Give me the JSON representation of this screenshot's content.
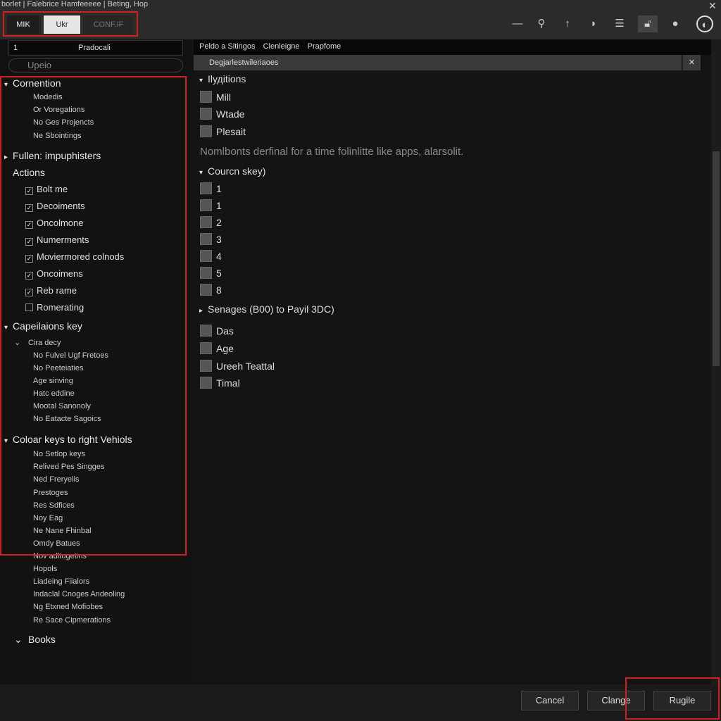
{
  "title": "borlet | Falebrice Hamfeeeee | Beting, Hop",
  "toolbar": {
    "segments": [
      "MIK",
      "Ukr",
      "CONF.IF"
    ],
    "icons": [
      "minimize-icon",
      "search-icon",
      "pin-icon",
      "shield-icon",
      "menu-icon",
      "lock-icon",
      "chat-icon",
      "globe-icon"
    ]
  },
  "left": {
    "field_number": "1",
    "field_value": "Pradocali",
    "search_placeholder": "Upeio",
    "rows": [
      {
        "t": "h1",
        "arrow": "▾",
        "text": "Cornention"
      },
      {
        "t": "h2",
        "text": "Modedis"
      },
      {
        "t": "h2",
        "text": "Or Voregations"
      },
      {
        "t": "h2",
        "text": "No Ges Projencts"
      },
      {
        "t": "h2",
        "text": "Ne Sbointings"
      },
      {
        "t": "h1",
        "arrow": "▸",
        "text": "Fullen: impuphisters"
      },
      {
        "t": "h1",
        "arrow": "",
        "text": "Actions"
      },
      {
        "t": "chk",
        "text": "Bolt me",
        "checked": true
      },
      {
        "t": "chk",
        "text": "Decoiments",
        "checked": true
      },
      {
        "t": "chk",
        "text": "Oncolmone",
        "checked": true
      },
      {
        "t": "chk",
        "text": "Numerments",
        "checked": true
      },
      {
        "t": "chk",
        "text": "Moviermored colnods",
        "checked": true
      },
      {
        "t": "chk",
        "text": "Oncoimens",
        "checked": true
      },
      {
        "t": "chk",
        "text": "Reb rame",
        "checked": true
      },
      {
        "t": "chk",
        "text": "Romerating",
        "checked": false
      },
      {
        "t": "h1",
        "arrow": "▾",
        "text": "Capeilaions key"
      },
      {
        "t": "sub",
        "arrow": "⌄",
        "text": "Cira decy"
      },
      {
        "t": "h2",
        "text": "No Fulvel Ugf Fretoes"
      },
      {
        "t": "h2",
        "text": "No Peeteiaties"
      },
      {
        "t": "h2",
        "text": "Age sinving"
      },
      {
        "t": "h2",
        "text": "Hatc eddine"
      },
      {
        "t": "h2",
        "text": "Mootal Sanonoly"
      },
      {
        "t": "h2",
        "text": "No Eatacte Sagoics"
      },
      {
        "t": "h1",
        "arrow": "▾",
        "text": "Coloar keys to right Vehiols"
      },
      {
        "t": "h2",
        "text": "No Setlop keys"
      },
      {
        "t": "h2",
        "text": "Relived Pes Singges"
      },
      {
        "t": "h2",
        "text": "Ned Freryelis"
      },
      {
        "t": "h2",
        "text": "Prestoges"
      },
      {
        "t": "h2",
        "text": "Res Sdfices"
      },
      {
        "t": "h2",
        "text": "Noy Eag"
      },
      {
        "t": "h2",
        "text": "Ne Nane Fhinbal"
      },
      {
        "t": "h2",
        "text": "Omdy Batues"
      },
      {
        "t": "h2",
        "text": "Nov adltugetins"
      },
      {
        "t": "h2",
        "text": "Hopols"
      },
      {
        "t": "h2",
        "text": "Liadeing Fiialors"
      },
      {
        "t": "h2",
        "text": "Indaclal Cnoges Andeoling"
      },
      {
        "t": "h2",
        "text": "Ng Etxned Mofiobes"
      },
      {
        "t": "h2",
        "text": "Re Sace Cipmerations"
      },
      {
        "t": "sub",
        "arrow": "⌄",
        "text": "Books"
      }
    ]
  },
  "right": {
    "tabs": [
      "Peldo a Sitingos",
      "Clenleigne",
      "Prapfome"
    ],
    "subheader": "Degjarlestwileriaoes",
    "rows": [
      {
        "t": "sec",
        "arrow": "▾",
        "text": "Ilудitions"
      },
      {
        "t": "box",
        "text": "Mill"
      },
      {
        "t": "box",
        "text": "Wtade"
      },
      {
        "t": "box",
        "text": "Plesait"
      },
      {
        "t": "note",
        "text": "Nomlbonts derfinal for a time folinlitte like apps, alarsolit."
      },
      {
        "t": "sec",
        "arrow": "▾",
        "text": "Courcn skey)"
      },
      {
        "t": "box",
        "text": "1"
      },
      {
        "t": "box",
        "text": "1"
      },
      {
        "t": "box",
        "text": "2"
      },
      {
        "t": "box",
        "text": "3"
      },
      {
        "t": "box",
        "text": "4"
      },
      {
        "t": "box",
        "text": "5"
      },
      {
        "t": "box",
        "text": "8"
      },
      {
        "t": "sec",
        "arrow": "▸",
        "text": "Senages (B00) to Payil 3DC)"
      },
      {
        "t": "box",
        "text": "Das"
      },
      {
        "t": "box",
        "text": "Age"
      },
      {
        "t": "box",
        "text": "Ureeh Teattal"
      },
      {
        "t": "box",
        "text": "Timal"
      }
    ]
  },
  "footer": {
    "cancel": "Cancel",
    "change": "Clange",
    "apply": "Rugile"
  },
  "colors": {
    "highlight": "#d02020",
    "panel": "#141414",
    "toolbar": "#2b2b2b"
  }
}
